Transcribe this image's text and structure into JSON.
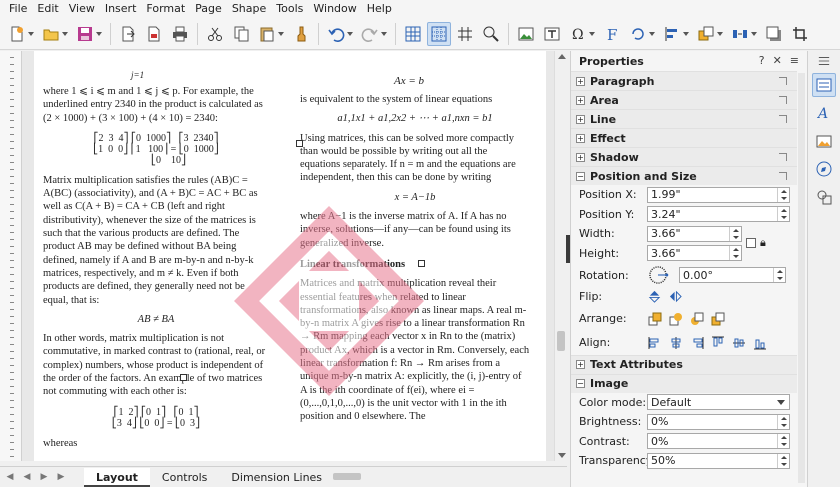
{
  "menu": [
    "File",
    "Edit",
    "View",
    "Insert",
    "Format",
    "Page",
    "Shape",
    "Tools",
    "Window",
    "Help"
  ],
  "toolbar": {
    "icons": [
      "new-icon",
      "open-icon",
      "save-icon",
      "export-icon",
      "export-pdf-icon",
      "print-icon",
      "cut-icon",
      "copy-icon",
      "paste-icon",
      "clone-formatting-icon",
      "undo-icon",
      "redo-icon",
      "grid-icon",
      "helplines-icon",
      "snap-icon",
      "zoom-icon",
      "image-icon",
      "textbox-icon",
      "special-character-icon",
      "fontwork-icon",
      "rotate-icon",
      "align-icon",
      "arrange-icon",
      "distribute-icon",
      "shadow-icon",
      "crop-icon"
    ]
  },
  "document": {
    "top_eq_left": "j=1",
    "top_eq_right": "Ax = b",
    "col1": [
      "where 1 ⩽ i ⩽ m and 1 ⩽ j ⩽ p. For example, the underlined entry 2340 in the product is calculated as (2 × 1000) + (3 × 100) + (4 × 10) = 2340:",
      "Matrix multiplication satisfies the rules (AB)C = A(BC) (associativity), and (A + B)C = AC + BC as well as C(A + B) = CA + CB (left and right distributivity), whenever the size of the matrices is such that the various products are defined. The product AB may be defined without BA being defined, namely if A and B are m-by-n and n-by-k matrices, respectively, and m ≠ k. Even if both products are defined, they generally need not be equal, that is:",
      "AB ≠ BA",
      "In other words, matrix multiplication is not commutative, in marked contrast to (rational, real, or complex) numbers, whose product is independent of the order of the factors. An example of two matrices not commuting with each other is:",
      "whereas"
    ],
    "col2": [
      "is equivalent to the system of linear equations",
      "a1,1x1 + a1,2x2 + ⋯ + a1,nxn = b1",
      "Using matrices, this can be solved more compactly than would be possible by writing out all the equations separately. If n = m and the equations are independent, then this can be done by writing",
      "x = A−1b",
      "where A−1 is the inverse matrix of A. If A has no inverse, solutions—if any—can be found using its generalized inverse.",
      "Linear transformations",
      "Matrices and matrix multiplication reveal their essential features when related to linear transformations, also known as linear maps. A real m-by-n matrix A gives rise to a linear transformation Rn → Rm mapping each vector x in Rn to the (matrix) product Ax, which is a vector in Rm. Conversely, each linear transformation f: Rn → Rm arises from a unique m-by-n matrix A: explicitly, the (i, j)-entry of A is the ith coordinate of f(ei), where ei = (0,...,0,1,0,...,0) is the unit vector with 1 in the ith position and 0 elsewhere. The"
    ],
    "matrix1": "⎡2  3  4⎤ ⎡0  1000⎤   ⎡3  2340⎤\n⎣1  0  0⎦ ⎢1   100⎥ = ⎣0  1000⎦\n          ⎣0    10⎦",
    "matrix2": "⎡1  2⎤ ⎡0  1⎤   ⎡0  1⎤\n⎣3  4⎦ ⎣0  0⎦ = ⎣0  3⎦"
  },
  "tabs": [
    "Layout",
    "Controls",
    "Dimension Lines"
  ],
  "active_tab": "Layout",
  "properties": {
    "title": "Properties",
    "sections": {
      "paragraph": "Paragraph",
      "area": "Area",
      "line": "Line",
      "effect": "Effect",
      "shadow": "Shadow",
      "position_size": "Position and Size",
      "text_attributes": "Text Attributes",
      "image": "Image"
    },
    "position_x_label": "Position X:",
    "position_x": "1.99\"",
    "position_y_label": "Position Y:",
    "position_y": "3.24\"",
    "width_label": "Width:",
    "width": "3.66\"",
    "height_label": "Height:",
    "height": "3.66\"",
    "rotation_label": "Rotation:",
    "rotation": "0.00°",
    "flip_label": "Flip:",
    "arrange_label": "Arrange:",
    "align_label": "Align:",
    "color_mode_label": "Color mode:",
    "color_mode": "Default",
    "brightness_label": "Brightness:",
    "brightness": "0%",
    "contrast_label": "Contrast:",
    "contrast": "0%",
    "transparency_label": "Transparency:",
    "transparency": "50%"
  },
  "colors": {
    "accent": "#cfe0f3",
    "watermark": "#e8788f",
    "panel_bg": "#f5f5f5"
  }
}
